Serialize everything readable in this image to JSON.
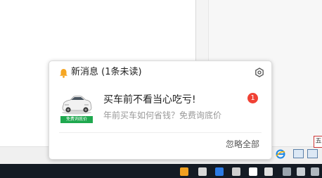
{
  "notification": {
    "title": "新消息 (1条未读)",
    "item": {
      "title": "买车前不看当心吃亏!",
      "subtitle": "年前买车如何省钱？免费询底价",
      "thumbnail_tag": "免费询底价",
      "unread_count": "1"
    },
    "ignore_all_label": "忽略全部"
  },
  "background": {
    "corner_label": "五"
  },
  "icons": {
    "bell": "bell-icon",
    "settings": "gear-icon"
  },
  "colors": {
    "bell": "#f5a623",
    "badge": "#f04134",
    "tag": "#1fa84f",
    "taskbar": "#141b24"
  }
}
